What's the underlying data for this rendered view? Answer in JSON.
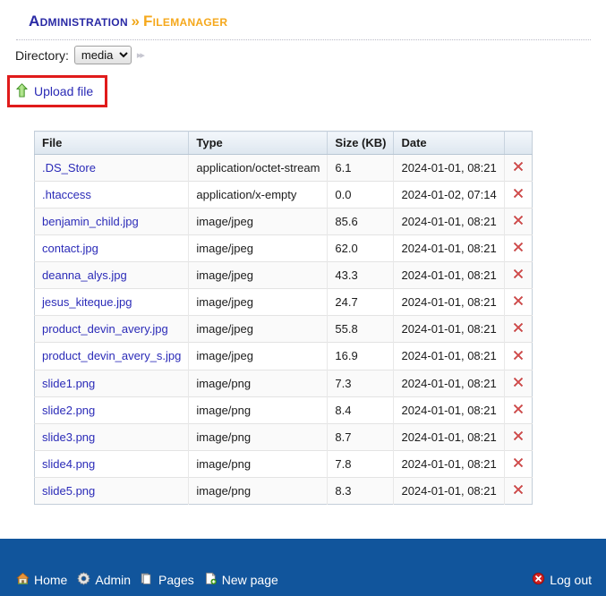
{
  "header": {
    "breadcrumb_admin": "Administration",
    "breadcrumb_separator": "»",
    "breadcrumb_page": "Filemanager",
    "color_admin": "#2a2aa5",
    "color_page": "#f5a81c"
  },
  "directory": {
    "label": "Directory:",
    "selected": "media",
    "options": [
      "media"
    ],
    "chevrons": "▸▸"
  },
  "upload": {
    "label": "Upload file",
    "icon": "arrow-up-icon",
    "highlight_color": "#e01b1b"
  },
  "table": {
    "columns": [
      "File",
      "Type",
      "Size (KB)",
      "Date",
      ""
    ],
    "rows": [
      {
        "file": ".DS_Store",
        "type": "application/octet-stream",
        "size": "6.1",
        "date": "2024-01-01, 08:21",
        "delete": "delete-icon"
      },
      {
        "file": ".htaccess",
        "type": "application/x-empty",
        "size": "0.0",
        "date": "2024-01-02, 07:14",
        "delete": "delete-icon"
      },
      {
        "file": "benjamin_child.jpg",
        "type": "image/jpeg",
        "size": "85.6",
        "date": "2024-01-01, 08:21",
        "delete": "delete-icon"
      },
      {
        "file": "contact.jpg",
        "type": "image/jpeg",
        "size": "62.0",
        "date": "2024-01-01, 08:21",
        "delete": "delete-icon"
      },
      {
        "file": "deanna_alys.jpg",
        "type": "image/jpeg",
        "size": "43.3",
        "date": "2024-01-01, 08:21",
        "delete": "delete-icon"
      },
      {
        "file": "jesus_kiteque.jpg",
        "type": "image/jpeg",
        "size": "24.7",
        "date": "2024-01-01, 08:21",
        "delete": "delete-icon"
      },
      {
        "file": "product_devin_avery.jpg",
        "type": "image/jpeg",
        "size": "55.8",
        "date": "2024-01-01, 08:21",
        "delete": "delete-icon"
      },
      {
        "file": "product_devin_avery_s.jpg",
        "type": "image/jpeg",
        "size": "16.9",
        "date": "2024-01-01, 08:21",
        "delete": "delete-icon"
      },
      {
        "file": "slide1.png",
        "type": "image/png",
        "size": "7.3",
        "date": "2024-01-01, 08:21",
        "delete": "delete-icon"
      },
      {
        "file": "slide2.png",
        "type": "image/png",
        "size": "8.4",
        "date": "2024-01-01, 08:21",
        "delete": "delete-icon"
      },
      {
        "file": "slide3.png",
        "type": "image/png",
        "size": "8.7",
        "date": "2024-01-01, 08:21",
        "delete": "delete-icon"
      },
      {
        "file": "slide4.png",
        "type": "image/png",
        "size": "7.8",
        "date": "2024-01-01, 08:21",
        "delete": "delete-icon"
      },
      {
        "file": "slide5.png",
        "type": "image/png",
        "size": "8.3",
        "date": "2024-01-01, 08:21",
        "delete": "delete-icon"
      }
    ]
  },
  "footer": {
    "background": "#11559c",
    "items": [
      {
        "label": "Home",
        "icon": "home-icon"
      },
      {
        "label": "Admin",
        "icon": "gear-icon"
      },
      {
        "label": "Pages",
        "icon": "pages-icon"
      },
      {
        "label": "New page",
        "icon": "new-page-icon"
      }
    ],
    "logout": {
      "label": "Log out",
      "icon": "logout-icon"
    }
  }
}
